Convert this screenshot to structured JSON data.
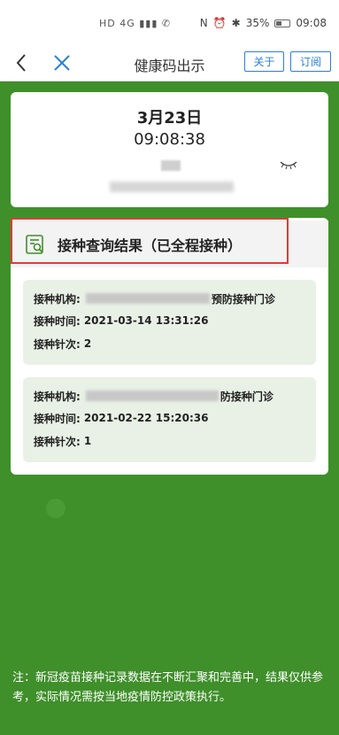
{
  "status_bar": {
    "left_icons": "HD 4G ▮▮▮ ✆",
    "battery_percent": "35%",
    "time": "09:08"
  },
  "nav": {
    "title": "健康码出示",
    "about_label": "关于",
    "subscribe_label": "订阅"
  },
  "date_card": {
    "date": "3月23日",
    "time": "09:08:38"
  },
  "result": {
    "title": "接种查询结果（已全程接种）",
    "records": [
      {
        "institution_label": "接种机构:",
        "institution_suffix": "预防接种门诊",
        "time_label": "接种时间:",
        "time_value": "2021-03-14 13:31:26",
        "dose_label": "接种针次:",
        "dose_value": "2"
      },
      {
        "institution_label": "接种机构:",
        "institution_suffix": "防接种门诊",
        "time_label": "接种时间:",
        "time_value": "2021-02-22 15:20:36",
        "dose_label": "接种针次:",
        "dose_value": "1"
      }
    ]
  },
  "footnote": "注：新冠疫苗接种记录数据在不断汇聚和完善中，结果仅供参考，实际情况需按当地疫情防控政策执行。",
  "colors": {
    "background_green": "#3f8f2a",
    "highlight_red": "#e23b34",
    "button_blue": "#2d7fd6",
    "record_bg": "#e9f1e6"
  }
}
